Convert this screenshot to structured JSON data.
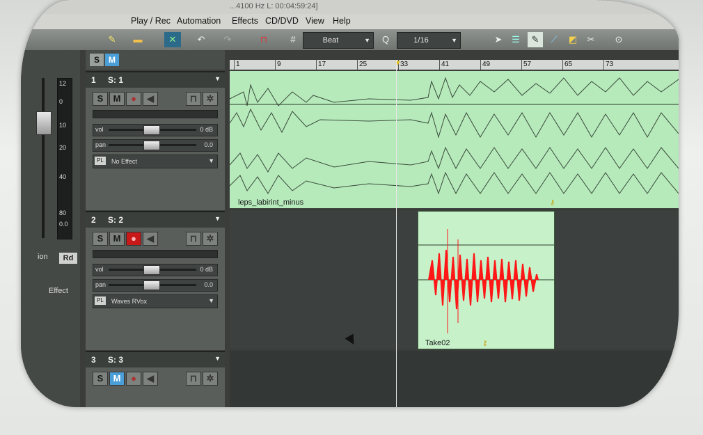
{
  "window": {
    "title": "...4100 Hz L: 00:04:59:24]"
  },
  "menu": [
    "Play / Rec",
    "Automation",
    "Effects",
    "CD/DVD",
    "View",
    "Help"
  ],
  "toolbar": {
    "snap_mode": "Beat",
    "quantize_label": "Q",
    "quantize_value": "1/16"
  },
  "mixer": {
    "meter_ticks": [
      "12",
      "0",
      "10",
      "20",
      "40",
      "80",
      "0.0"
    ],
    "ion_label": "ion",
    "rd_button": "Rd",
    "effect_label": "Effect"
  },
  "header": {
    "solo_label": "S",
    "mute_label": "M"
  },
  "ruler": [
    "1",
    "9",
    "17",
    "25",
    "33",
    "41",
    "49",
    "57",
    "65",
    "73"
  ],
  "tracks": [
    {
      "num": "1",
      "name": "S: 1",
      "solo": "S",
      "mute": "M",
      "vol_label": "vol",
      "vol_value": "0 dB",
      "pan_label": "pan",
      "pan_value": "0.0",
      "pl_label": "PL",
      "plugin": "No Effect",
      "armed": false
    },
    {
      "num": "2",
      "name": "S: 2",
      "solo": "S",
      "mute": "M",
      "vol_label": "vol",
      "vol_value": "0 dB",
      "pan_label": "pan",
      "pan_value": "0.0",
      "pl_label": "PL",
      "plugin": "Waves RVox",
      "armed": true
    },
    {
      "num": "3",
      "name": "S: 3",
      "solo": "S",
      "mute": "M",
      "armed": false
    }
  ],
  "clips": [
    {
      "name": "leps_labirint_minus",
      "color": "#b6eabb"
    },
    {
      "name": "Take02",
      "color": "#c7f1c9",
      "wave_color": "#ff1010"
    }
  ],
  "colors": {
    "record_active": "#e02020",
    "playhead": "#e8e8e8"
  }
}
